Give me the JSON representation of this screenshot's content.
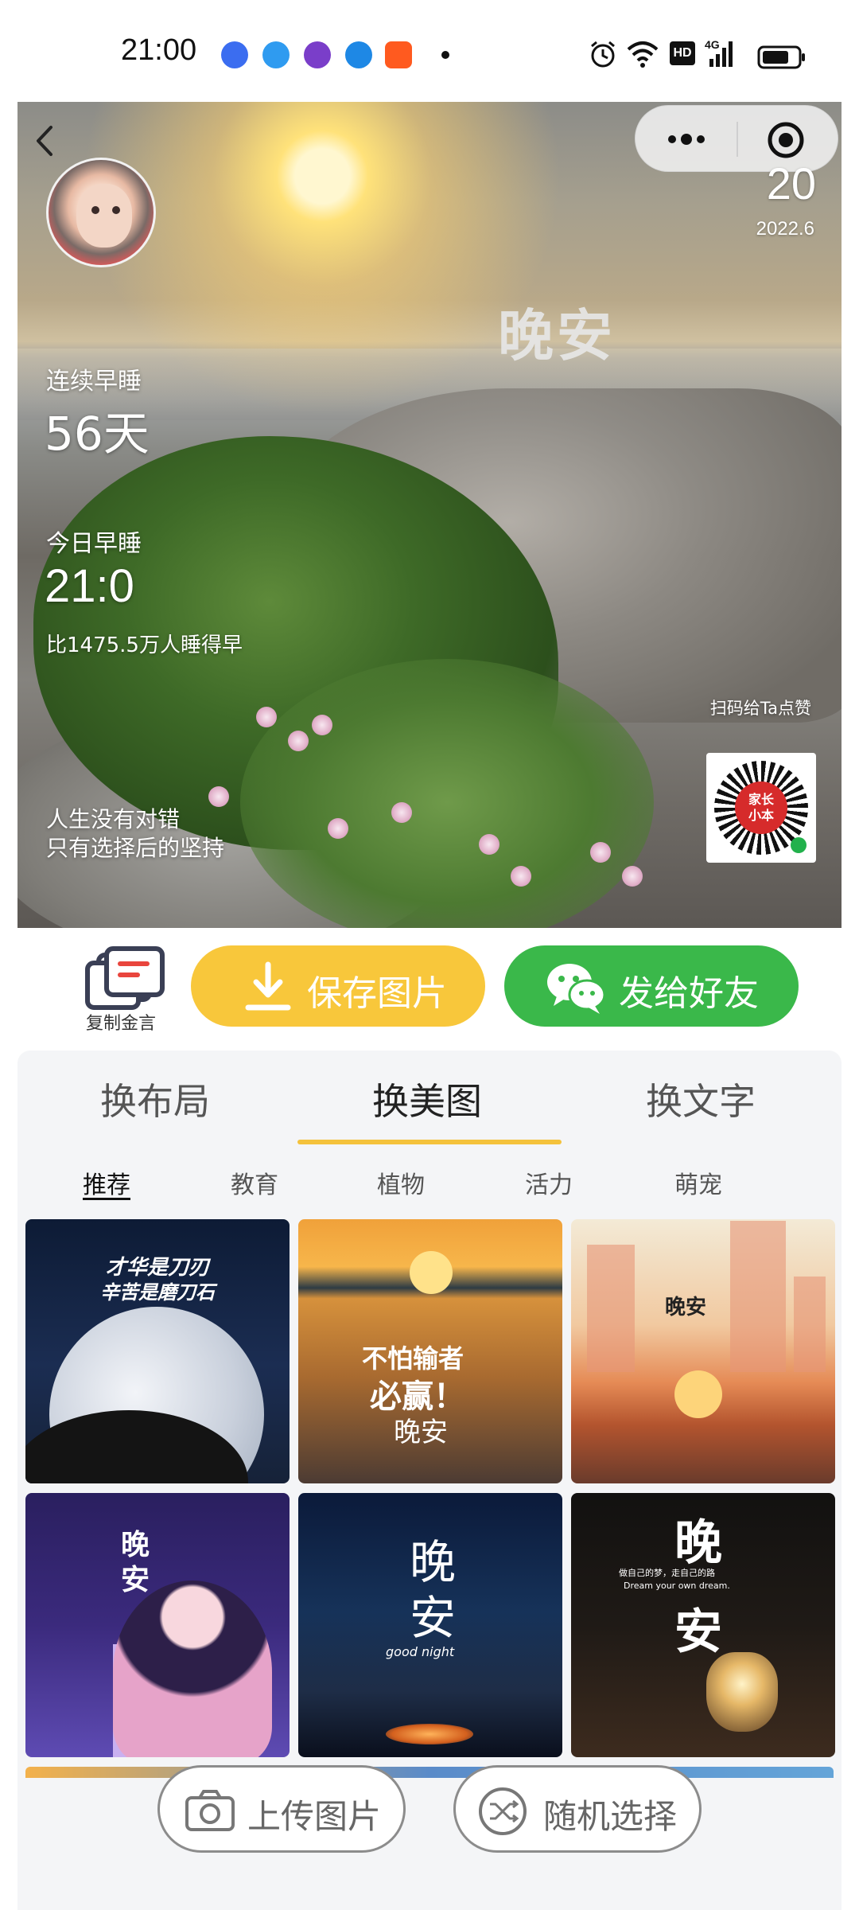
{
  "status_bar": {
    "time": "21:00",
    "network": "4G",
    "hd": "HD"
  },
  "poster": {
    "title": "晚安",
    "day_number": "20",
    "year_month": "2022.6",
    "streak_label": "连续早睡",
    "streak_value": "56天",
    "today_label": "今日早睡",
    "today_value": "21:0",
    "compare_text": "比1475.5万人睡得早",
    "quote_line1": "人生没有对错",
    "quote_line2": "只有选择后的坚持",
    "qr_hint": "扫码给Ta点赞",
    "qr_center_line1": "家长",
    "qr_center_line2": "小本"
  },
  "actions": {
    "copy_label": "复制金言",
    "save_label": "保存图片",
    "share_label": "发给好友",
    "save_color": "#f8c73b",
    "share_color": "#3ab84a"
  },
  "tabs": [
    {
      "label": "换布局"
    },
    {
      "label": "换美图",
      "active": true
    },
    {
      "label": "换文字"
    }
  ],
  "subtabs": [
    {
      "label": "推荐",
      "active": true
    },
    {
      "label": "教育"
    },
    {
      "label": "植物"
    },
    {
      "label": "活力"
    },
    {
      "label": "萌宠"
    }
  ],
  "thumbnails": {
    "t1_line1": "才华是刀刃",
    "t1_line2": "辛苦是磨刀石",
    "t2_line1": "不怕输者",
    "t2_line2": "必赢！",
    "t2_line3": "晚安",
    "t3_text": "晚安",
    "t4_line1": "晚",
    "t4_line2": "安",
    "t5_line1": "晚",
    "t5_line2": "安",
    "t5_sub": "good night",
    "t6_line1": "晚",
    "t6_sub1": "做自己的梦，走自己的路",
    "t6_sub2": "Dream your own dream.",
    "t6_line2": "安"
  },
  "bottom_actions": {
    "upload_label": "上传图片",
    "random_label": "随机选择"
  }
}
